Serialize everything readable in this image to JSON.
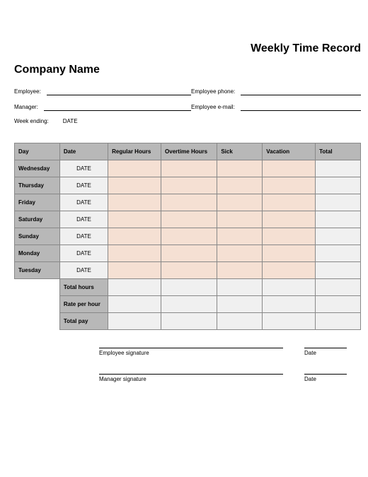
{
  "title": "Weekly Time Record",
  "company": "Company Name",
  "fields": {
    "employee_label": "Employee:",
    "employee_value": "",
    "phone_label": "Employee phone:",
    "phone_value": "",
    "manager_label": "Manager:",
    "manager_value": "",
    "email_label": "Employee e-mail:",
    "email_value": "",
    "week_ending_label": "Week ending:",
    "week_ending_value": "DATE"
  },
  "headers": {
    "day": "Day",
    "date": "Date",
    "regular": "Regular Hours",
    "overtime": "Overtime Hours",
    "sick": "Sick",
    "vacation": "Vacation",
    "total": "Total"
  },
  "rows": [
    {
      "day": "Wednesday",
      "date": "DATE"
    },
    {
      "day": "Thursday",
      "date": "DATE"
    },
    {
      "day": "Friday",
      "date": "DATE"
    },
    {
      "day": "Saturday",
      "date": "DATE"
    },
    {
      "day": "Sunday",
      "date": "DATE"
    },
    {
      "day": "Monday",
      "date": "DATE"
    },
    {
      "day": "Tuesday",
      "date": "DATE"
    }
  ],
  "summary": {
    "total_hours": "Total hours",
    "rate_per_hour": "Rate per hour",
    "total_pay": "Total pay"
  },
  "signatures": {
    "employee": "Employee signature",
    "manager": "Manager signature",
    "date": "Date"
  }
}
